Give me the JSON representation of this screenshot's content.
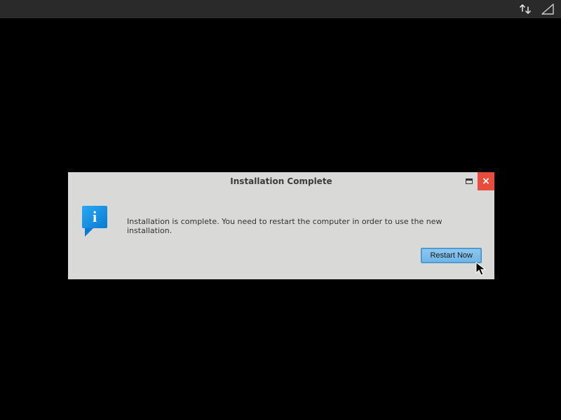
{
  "topbar": {
    "network_icon": "network-updown-icon",
    "signal_icon": "cellular-signal-icon"
  },
  "dialog": {
    "title": "Installation Complete",
    "message": "Installation is complete. You need to restart the computer in order to use the new installation.",
    "restart_label": "Restart Now",
    "close_glyph": "×",
    "info_icon_letter": "i"
  }
}
